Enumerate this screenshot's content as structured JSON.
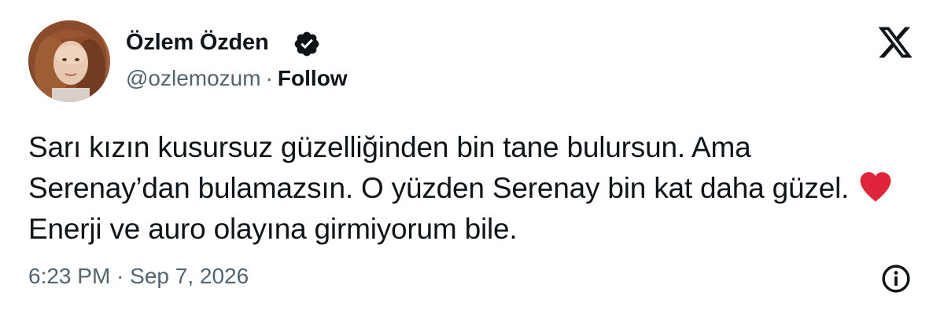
{
  "author": {
    "name": "Özlem Özden",
    "handle": "@ozlemozum",
    "separator": "·",
    "follow_label": "Follow",
    "verified": true
  },
  "tweet": {
    "text_before_emoji": "Sarı kızın kusursuz güzelliğinden bin tane bulursun. Ama Serenay’dan bulamazsın. O yüzden Serenay bin kat daha güzel.",
    "emoji": "red-heart",
    "text_after_emoji": "Enerji ve auro olayına girmiyorum bile."
  },
  "timestamp": "6:23 PM · Sep 7, 2026",
  "icons": {
    "logo": "x-logo-icon",
    "verified": "verified-badge-icon",
    "info": "info-icon",
    "heart": "red-heart-icon"
  },
  "colors": {
    "text": "#0f1419",
    "secondary": "#536471",
    "heart": "#e0243a",
    "background": "#ffffff"
  }
}
